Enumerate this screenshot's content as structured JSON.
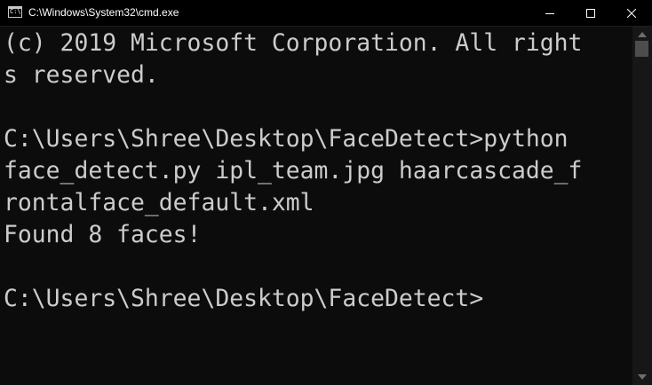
{
  "window": {
    "title": "C:\\Windows\\System32\\cmd.exe",
    "icon": "cmd-icon",
    "icon_glyph": "C:\\"
  },
  "controls": {
    "minimize_icon": "minimize-icon",
    "maximize_icon": "maximize-icon",
    "close_icon": "close-icon"
  },
  "console": {
    "foreground": "#cccccc",
    "background": "#0c0c0c",
    "lines": [
      "(c) 2019 Microsoft Corporation. All right",
      "s reserved.",
      "",
      "C:\\Users\\Shree\\Desktop\\FaceDetect>python",
      "face_detect.py ipl_team.jpg haarcascade_f",
      "rontalface_default.xml",
      "Found 8 faces!",
      "",
      "C:\\Users\\Shree\\Desktop\\FaceDetect>",
      "",
      ""
    ]
  },
  "scrollbar": {
    "up_icon": "scroll-up-arrow-icon",
    "down_icon": "scroll-down-arrow-icon"
  }
}
